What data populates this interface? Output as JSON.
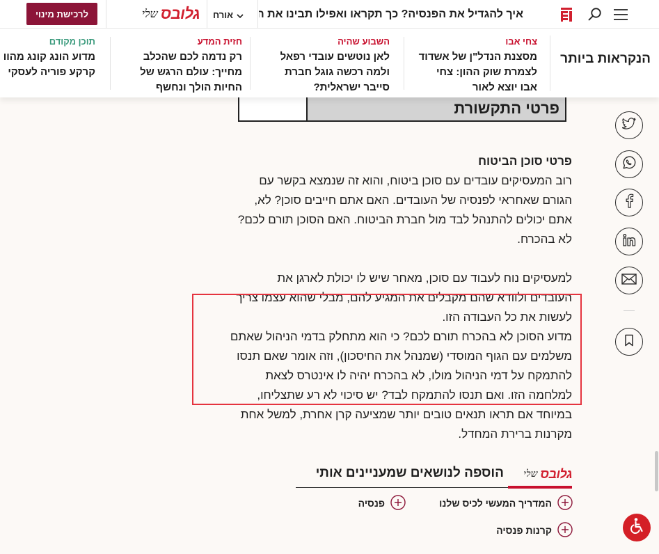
{
  "colors": {
    "brand_red": "#d11f2e",
    "subscribe_bg": "#8c1538",
    "category_red": "#c8102e",
    "category_green": "#3a9a7c",
    "page_bg": "#fcf9f6",
    "highlight_border": "#e5343f",
    "accessibility_bg": "#d41f26"
  },
  "header": {
    "subscribe_label": "לרכישת מינוי",
    "logo": {
      "name": "גלובס",
      "suffix": "שלי"
    },
    "user_label": "אורח",
    "headline": "איך להגדיל את הפנסיה? כך תקראו ואפילו תבינו את הדוח",
    "icons": [
      "globes-icon",
      "search-icon",
      "menu-icon",
      "chevron-down-icon"
    ]
  },
  "most_read": {
    "title": "הנקראות ביותר",
    "items": [
      {
        "category": "צחי אבו",
        "category_color": "#c8102e",
        "title_lines": [
          "מסצנת הנדל\"ן של אשדוד",
          "לצמרת שוק ההון: צחי",
          "אבו יוצא לאור"
        ]
      },
      {
        "category": "השבוע שהיה",
        "category_color": "#c8102e",
        "title_lines": [
          "לאן נוטשים עובדי רפאל",
          "ולמה רכשה גוגל חברת",
          "סייבר ישראלית?"
        ]
      },
      {
        "category": "חזית המדע",
        "category_color": "#c8102e",
        "title_lines": [
          "רק נדמה לכם שהכלב",
          "מחייך: עולם הרגש של",
          "החיות הולך ונחשף"
        ]
      },
      {
        "category": "תוכן מקודם",
        "category_color": "#3a9a7c",
        "title_lines": [
          "מדוע הונג קונג מהוו",
          "קרקע פוריה לעסקי"
        ]
      }
    ]
  },
  "article": {
    "image_table_label": "פרטי התקשורת",
    "section_heading": "פרטי סוכן הביטוח",
    "paragraphs": [
      {
        "lines": [
          "רוב המעסיקים עובדים עם סוכן ביטוח, והוא זה שנמצא בקשר עם",
          "הגורם שאחראי לפנסיה של העובדים. האם אתם חייבים סוכן? לא,",
          "אתם יכולים להתנהל לבד מול חברת הביטוח. האם הסוכן תורם לכם?",
          "לא בהכרח."
        ]
      },
      {
        "lines": [
          "למעסיקים נוח לעבוד עם סוכן, מאחר שיש לו יכולת לארגן את",
          "העובדים ולוודא שהם מקבלים את המגיע להם, מבלי שהוא עצמו צריך",
          "לעשות את כל העבודה הזו.",
          "מדוע הסוכן לא בהכרח תורם לכם? כי הוא מתחלק בדמי הניהול שאתם",
          "משלמים עם הגוף המוסדי (שמנהל את החיסכון), וזה אומר שאם תנסו",
          "להתמקח על דמי הניהול מולו, לא בהכרח יהיה לו אינטרס לצאת",
          "למלחמה הזו. ואם תנסו להתמקח לבד? יש סיכוי לא רע שתצליחו,",
          "במיוחד אם תראו תנאים טובים יותר שמציעה קרן אחרת, למשל אחת",
          "מקרנות ברירת המחדל."
        ]
      }
    ]
  },
  "share": {
    "buttons": [
      {
        "icon": "twitter-icon"
      },
      {
        "icon": "whatsapp-icon"
      },
      {
        "icon": "facebook-icon"
      },
      {
        "icon": "linkedin-icon"
      },
      {
        "icon": "email-icon"
      },
      {
        "icon": "bookmark-icon"
      }
    ]
  },
  "topics": {
    "title": "הוספה לנושאים שמעניינים אותי",
    "logo": {
      "name": "גלובס",
      "suffix": "שלי"
    },
    "items": [
      {
        "label": "המדריך המעשי לכיס שלנו",
        "icon": "plus-icon"
      },
      {
        "label": "פנסיה",
        "icon": "plus-icon"
      },
      {
        "label": "קרנות פנסיה",
        "icon": "plus-icon"
      }
    ]
  },
  "accessibility": {
    "icon": "accessibility-icon"
  }
}
